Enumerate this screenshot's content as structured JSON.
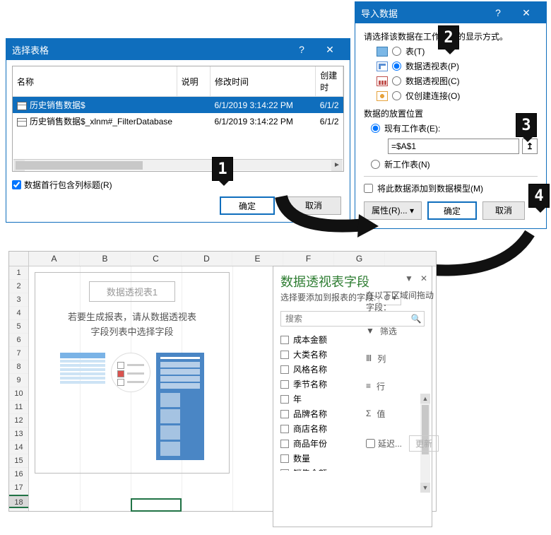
{
  "dlg_select": {
    "title": "选择表格",
    "col_name": "名称",
    "col_desc": "说明",
    "col_modified": "修改时间",
    "col_created": "创建时",
    "rows": [
      {
        "name": "历史销售数据$",
        "modified": "6/1/2019 3:14:22 PM",
        "created": "6/1/2"
      },
      {
        "name": "历史销售数据$_xlnm#_FilterDatabase",
        "modified": "6/1/2019 3:14:22 PM",
        "created": "6/1/2"
      }
    ],
    "first_row_header": "数据首行包含列标题(R)",
    "ok": "确定",
    "cancel": "取消"
  },
  "dlg_import": {
    "title": "导入数据",
    "prompt": "请选择该数据在工作簿中的显示方式。",
    "opt_table": "表(T)",
    "opt_pivot": "数据透视表(P)",
    "opt_chart": "数据透视图(C)",
    "opt_conn": "仅创建连接(O)",
    "placement_label": "数据的放置位置",
    "opt_existing": "现有工作表(E):",
    "ref_value": "=$A$1",
    "opt_new": "新工作表(N)",
    "add_model": "将此数据添加到数据模型(M)",
    "properties": "属性(R)...",
    "ok": "确定",
    "cancel": "取消"
  },
  "excel": {
    "cols": [
      "A",
      "B",
      "C",
      "D",
      "E",
      "F",
      "G"
    ],
    "pivot_title": "数据透视表1",
    "msg_l1": "若要生成报表，请从数据透视表",
    "msg_l2": "字段列表中选择字段"
  },
  "fields": {
    "title": "数据透视表字段",
    "sub": "选择要添加到报表的字段:",
    "search_ph": "搜索",
    "items": [
      "成本金额",
      "大类名称",
      "风格名称",
      "季节名称",
      "年",
      "品牌名称",
      "商店名称",
      "商品年份",
      "数量",
      "销售金额"
    ]
  },
  "zones": {
    "title": "在以下区域间拖动字段：",
    "filter": "筛选",
    "cols": "列",
    "rows": "行",
    "vals": "值",
    "defer": "延迟...",
    "update": "更新"
  },
  "callouts": {
    "c1": "1",
    "c2": "2",
    "c3": "3",
    "c4": "4"
  }
}
